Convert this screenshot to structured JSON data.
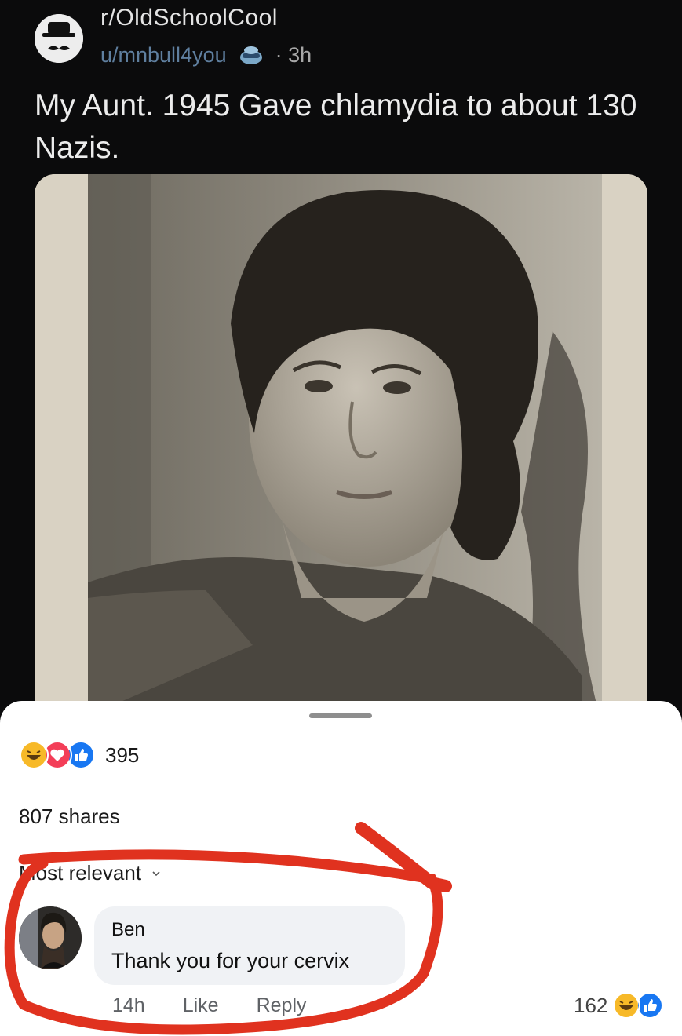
{
  "post": {
    "subreddit": "r/OldSchoolCool",
    "username": "u/mnbull4you",
    "time": "· 3h",
    "title": "My Aunt.  1945  Gave chlamydia to about 130 Nazis."
  },
  "facebook": {
    "reaction_count": "395",
    "reaction_icons": [
      "laugh-icon",
      "love-icon",
      "like-icon"
    ],
    "shares": "807 shares",
    "sort_label": "Most relevant",
    "comment": {
      "author": "Ben",
      "text": "Thank you for your cervix",
      "time": "14h",
      "like_label": "Like",
      "reply_label": "Reply",
      "reaction_count": "162",
      "reaction_icons": [
        "laugh-icon",
        "like-icon"
      ]
    }
  },
  "colors": {
    "reddit_bg": "#0b0b0c",
    "like_blue": "#1877f2",
    "love_red": "#f33e58",
    "laugh_yellow": "#f7b928",
    "annotation_red": "#e0321f"
  }
}
